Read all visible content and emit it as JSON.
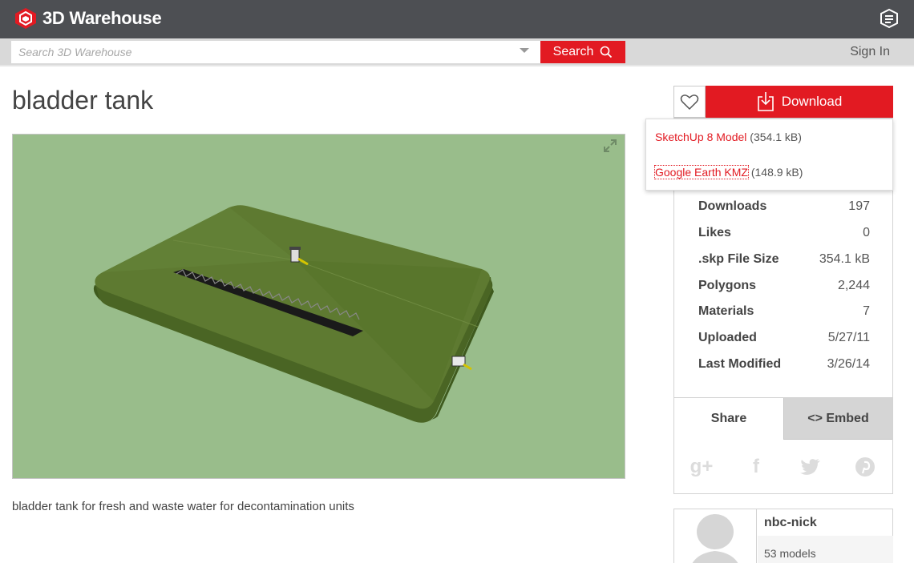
{
  "header": {
    "brand": "3D Warehouse"
  },
  "search": {
    "placeholder": "Search 3D Warehouse",
    "button_label": "Search",
    "signin_label": "Sign In"
  },
  "model": {
    "title": "bladder tank",
    "description": "bladder tank for fresh and waste water for decontamination units"
  },
  "download": {
    "button_label": "Download",
    "options": [
      {
        "label": "SketchUp 8 Model",
        "size": "(354.1 kB)"
      },
      {
        "label": "Google Earth KMZ",
        "size": "(148.9 kB)"
      }
    ]
  },
  "stats": [
    {
      "label": "Downloads",
      "value": "197"
    },
    {
      "label": "Likes",
      "value": "0"
    },
    {
      "label": ".skp File Size",
      "value": "354.1 kB"
    },
    {
      "label": "Polygons",
      "value": "2,244"
    },
    {
      "label": "Materials",
      "value": "7"
    },
    {
      "label": "Uploaded",
      "value": "5/27/11"
    },
    {
      "label": "Last Modified",
      "value": "3/26/14"
    }
  ],
  "tabs": {
    "share": "Share",
    "embed": "<> Embed"
  },
  "social_icons": [
    "google-plus-icon",
    "facebook-icon",
    "twitter-icon",
    "pinterest-icon"
  ],
  "author": {
    "name": "nbc-nick",
    "models": "53 models"
  },
  "colors": {
    "brand_red": "#e21a22",
    "topbar": "#4d4f53",
    "viewer_bg": "#99bd8b",
    "tank_green": "#55702c"
  }
}
